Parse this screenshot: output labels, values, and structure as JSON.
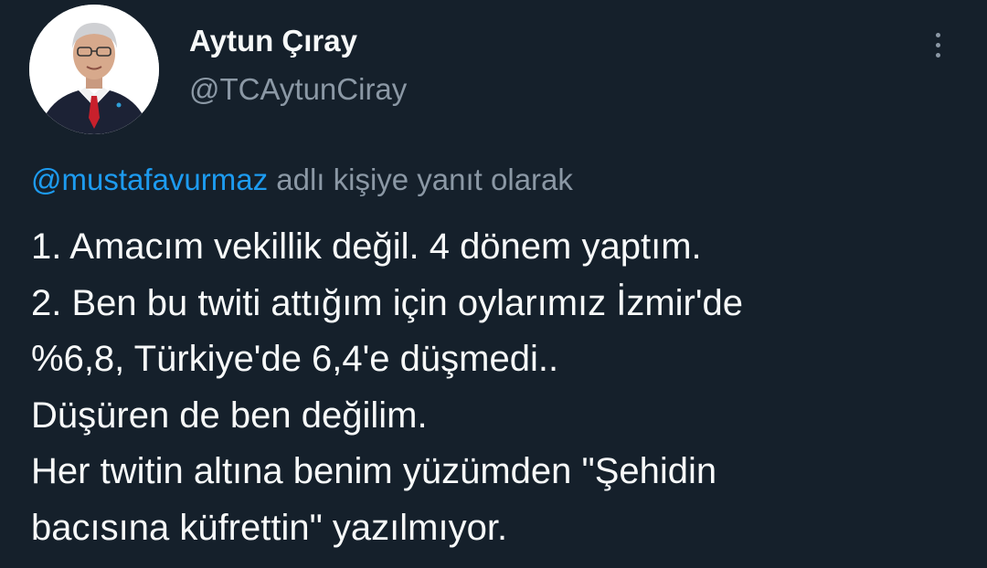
{
  "tweet": {
    "author": {
      "display_name": "Aytun Çıray",
      "handle": "@TCAytunCiray",
      "avatar_icon": "profile-photo"
    },
    "more_icon": "vertical-ellipsis-icon",
    "reply_context": {
      "mention": "@mustafavurmaz",
      "suffix": " adlı kişiye yanıt olarak"
    },
    "body_lines": [
      "1. Amacım vekillik değil. 4 dönem yaptım.",
      "2. Ben bu twiti attığım için oylarımız İzmir'de",
      "%6,8, Türkiye'de 6,4'e düşmedi..",
      "Düşüren de ben değilim.",
      "Her twitin altına benim yüzümden \"Şehidin",
      "bacısına küfrettin\" yazılmıyor."
    ]
  },
  "colors": {
    "background": "#15202b",
    "text_primary": "#f7f9f9",
    "text_secondary": "#8b98a5",
    "link": "#1d9bf0"
  }
}
